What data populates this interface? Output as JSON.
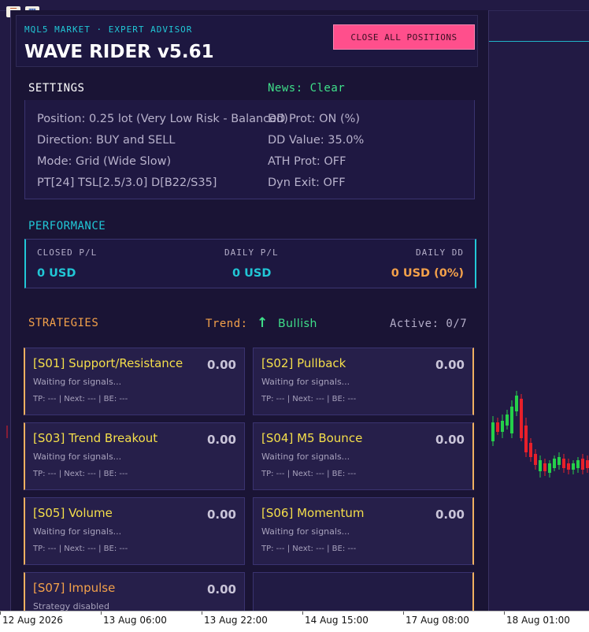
{
  "panel": {
    "subtitle": "MQL5 MARKET · EXPERT ADVISOR",
    "title": "WAVE RIDER v5.61",
    "close_all_label": "CLOSE ALL POSITIONS"
  },
  "settings": {
    "heading": "SETTINGS",
    "news": "News: Clear",
    "left": [
      "Position: 0.25 lot (Very Low Risk - Balanced)",
      "Direction: BUY and SELL",
      "Mode: Grid (Wide Slow)",
      "PT[24] TSL[2.5/3.0] D[B22/S35]"
    ],
    "right": [
      "DD Prot: ON (%)",
      "DD Value: 35.0%",
      "ATH Prot: OFF",
      "Dyn Exit: OFF"
    ]
  },
  "performance": {
    "heading": "PERFORMANCE",
    "closed_label": "CLOSED P/L",
    "closed_value": "0 USD",
    "daily_label": "DAILY P/L",
    "daily_value": "0 USD",
    "dd_label": "DAILY DD",
    "dd_value": "0 USD (0%)"
  },
  "strategies": {
    "heading": "STRATEGIES",
    "trend_label": "Trend:",
    "trend_value": "Bullish",
    "active": "Active: 0/7",
    "cards": [
      {
        "title": "[S01] Support/Resistance",
        "value": "0.00",
        "status": "Waiting for signals...",
        "foot": "TP: --- | Next: --- | BE: ---"
      },
      {
        "title": "[S02] Pullback",
        "value": "0.00",
        "status": "Waiting for signals...",
        "foot": "TP: --- | Next: --- | BE: ---"
      },
      {
        "title": "[S03] Trend Breakout",
        "value": "0.00",
        "status": "Waiting for signals...",
        "foot": "TP: --- | Next: --- | BE: ---"
      },
      {
        "title": "[S04] M5 Bounce",
        "value": "0.00",
        "status": "Waiting for signals...",
        "foot": "TP: --- | Next: --- | BE: ---"
      },
      {
        "title": "[S05] Volume",
        "value": "0.00",
        "status": "Waiting for signals...",
        "foot": "TP: --- | Next: --- | BE: ---"
      },
      {
        "title": "[S06] Momentum",
        "value": "0.00",
        "status": "Waiting for signals...",
        "foot": "TP: --- | Next: --- | BE: ---"
      },
      {
        "title": "[S07] Impulse",
        "value": "0.00",
        "status": "Strategy disabled",
        "foot": ""
      }
    ]
  },
  "chart": {
    "time_labels": [
      "12 Aug 2026",
      "13 Aug 06:00",
      "13 Aug 22:00",
      "14 Aug 15:00",
      "17 Aug 08:00",
      "18 Aug 01:00"
    ],
    "colors": {
      "bull": "#25d04a",
      "bear": "#e8202a",
      "line": "#21b3c8"
    }
  },
  "toolbar": {
    "icons": [
      "chart-list-icon",
      "chart-window-icon"
    ]
  }
}
